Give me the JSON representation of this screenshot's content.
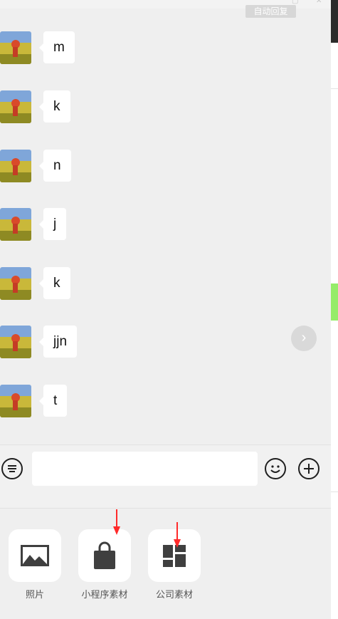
{
  "header": {
    "badge_text": "自动回复"
  },
  "messages": [
    {
      "text": "m"
    },
    {
      "text": "k"
    },
    {
      "text": "n"
    },
    {
      "text": "j"
    },
    {
      "text": "k"
    },
    {
      "text": "jjn"
    },
    {
      "text": "t"
    }
  ],
  "composer": {
    "input_value": "",
    "input_placeholder": ""
  },
  "tools": [
    {
      "label": "照片",
      "icon": "photo-icon"
    },
    {
      "label": "小程序素材",
      "icon": "shopping-bag-icon"
    },
    {
      "label": "公司素材",
      "icon": "dashboard-icon"
    }
  ],
  "colors": {
    "background": "#efefef",
    "bubble": "#ffffff",
    "accent_red": "#ff2a2a",
    "accent_green": "#95ec69"
  }
}
